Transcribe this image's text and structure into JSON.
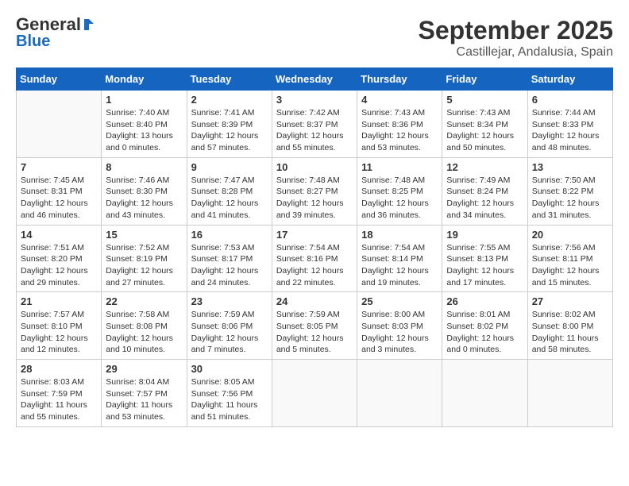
{
  "header": {
    "logo_line1": "General",
    "logo_line2": "Blue",
    "month": "September 2025",
    "location": "Castillejar, Andalusia, Spain"
  },
  "weekdays": [
    "Sunday",
    "Monday",
    "Tuesday",
    "Wednesday",
    "Thursday",
    "Friday",
    "Saturday"
  ],
  "weeks": [
    [
      {
        "day": "",
        "info": ""
      },
      {
        "day": "1",
        "info": "Sunrise: 7:40 AM\nSunset: 8:40 PM\nDaylight: 13 hours\nand 0 minutes."
      },
      {
        "day": "2",
        "info": "Sunrise: 7:41 AM\nSunset: 8:39 PM\nDaylight: 12 hours\nand 57 minutes."
      },
      {
        "day": "3",
        "info": "Sunrise: 7:42 AM\nSunset: 8:37 PM\nDaylight: 12 hours\nand 55 minutes."
      },
      {
        "day": "4",
        "info": "Sunrise: 7:43 AM\nSunset: 8:36 PM\nDaylight: 12 hours\nand 53 minutes."
      },
      {
        "day": "5",
        "info": "Sunrise: 7:43 AM\nSunset: 8:34 PM\nDaylight: 12 hours\nand 50 minutes."
      },
      {
        "day": "6",
        "info": "Sunrise: 7:44 AM\nSunset: 8:33 PM\nDaylight: 12 hours\nand 48 minutes."
      }
    ],
    [
      {
        "day": "7",
        "info": "Sunrise: 7:45 AM\nSunset: 8:31 PM\nDaylight: 12 hours\nand 46 minutes."
      },
      {
        "day": "8",
        "info": "Sunrise: 7:46 AM\nSunset: 8:30 PM\nDaylight: 12 hours\nand 43 minutes."
      },
      {
        "day": "9",
        "info": "Sunrise: 7:47 AM\nSunset: 8:28 PM\nDaylight: 12 hours\nand 41 minutes."
      },
      {
        "day": "10",
        "info": "Sunrise: 7:48 AM\nSunset: 8:27 PM\nDaylight: 12 hours\nand 39 minutes."
      },
      {
        "day": "11",
        "info": "Sunrise: 7:48 AM\nSunset: 8:25 PM\nDaylight: 12 hours\nand 36 minutes."
      },
      {
        "day": "12",
        "info": "Sunrise: 7:49 AM\nSunset: 8:24 PM\nDaylight: 12 hours\nand 34 minutes."
      },
      {
        "day": "13",
        "info": "Sunrise: 7:50 AM\nSunset: 8:22 PM\nDaylight: 12 hours\nand 31 minutes."
      }
    ],
    [
      {
        "day": "14",
        "info": "Sunrise: 7:51 AM\nSunset: 8:20 PM\nDaylight: 12 hours\nand 29 minutes."
      },
      {
        "day": "15",
        "info": "Sunrise: 7:52 AM\nSunset: 8:19 PM\nDaylight: 12 hours\nand 27 minutes."
      },
      {
        "day": "16",
        "info": "Sunrise: 7:53 AM\nSunset: 8:17 PM\nDaylight: 12 hours\nand 24 minutes."
      },
      {
        "day": "17",
        "info": "Sunrise: 7:54 AM\nSunset: 8:16 PM\nDaylight: 12 hours\nand 22 minutes."
      },
      {
        "day": "18",
        "info": "Sunrise: 7:54 AM\nSunset: 8:14 PM\nDaylight: 12 hours\nand 19 minutes."
      },
      {
        "day": "19",
        "info": "Sunrise: 7:55 AM\nSunset: 8:13 PM\nDaylight: 12 hours\nand 17 minutes."
      },
      {
        "day": "20",
        "info": "Sunrise: 7:56 AM\nSunset: 8:11 PM\nDaylight: 12 hours\nand 15 minutes."
      }
    ],
    [
      {
        "day": "21",
        "info": "Sunrise: 7:57 AM\nSunset: 8:10 PM\nDaylight: 12 hours\nand 12 minutes."
      },
      {
        "day": "22",
        "info": "Sunrise: 7:58 AM\nSunset: 8:08 PM\nDaylight: 12 hours\nand 10 minutes."
      },
      {
        "day": "23",
        "info": "Sunrise: 7:59 AM\nSunset: 8:06 PM\nDaylight: 12 hours\nand 7 minutes."
      },
      {
        "day": "24",
        "info": "Sunrise: 7:59 AM\nSunset: 8:05 PM\nDaylight: 12 hours\nand 5 minutes."
      },
      {
        "day": "25",
        "info": "Sunrise: 8:00 AM\nSunset: 8:03 PM\nDaylight: 12 hours\nand 3 minutes."
      },
      {
        "day": "26",
        "info": "Sunrise: 8:01 AM\nSunset: 8:02 PM\nDaylight: 12 hours\nand 0 minutes."
      },
      {
        "day": "27",
        "info": "Sunrise: 8:02 AM\nSunset: 8:00 PM\nDaylight: 11 hours\nand 58 minutes."
      }
    ],
    [
      {
        "day": "28",
        "info": "Sunrise: 8:03 AM\nSunset: 7:59 PM\nDaylight: 11 hours\nand 55 minutes."
      },
      {
        "day": "29",
        "info": "Sunrise: 8:04 AM\nSunset: 7:57 PM\nDaylight: 11 hours\nand 53 minutes."
      },
      {
        "day": "30",
        "info": "Sunrise: 8:05 AM\nSunset: 7:56 PM\nDaylight: 11 hours\nand 51 minutes."
      },
      {
        "day": "",
        "info": ""
      },
      {
        "day": "",
        "info": ""
      },
      {
        "day": "",
        "info": ""
      },
      {
        "day": "",
        "info": ""
      }
    ]
  ]
}
